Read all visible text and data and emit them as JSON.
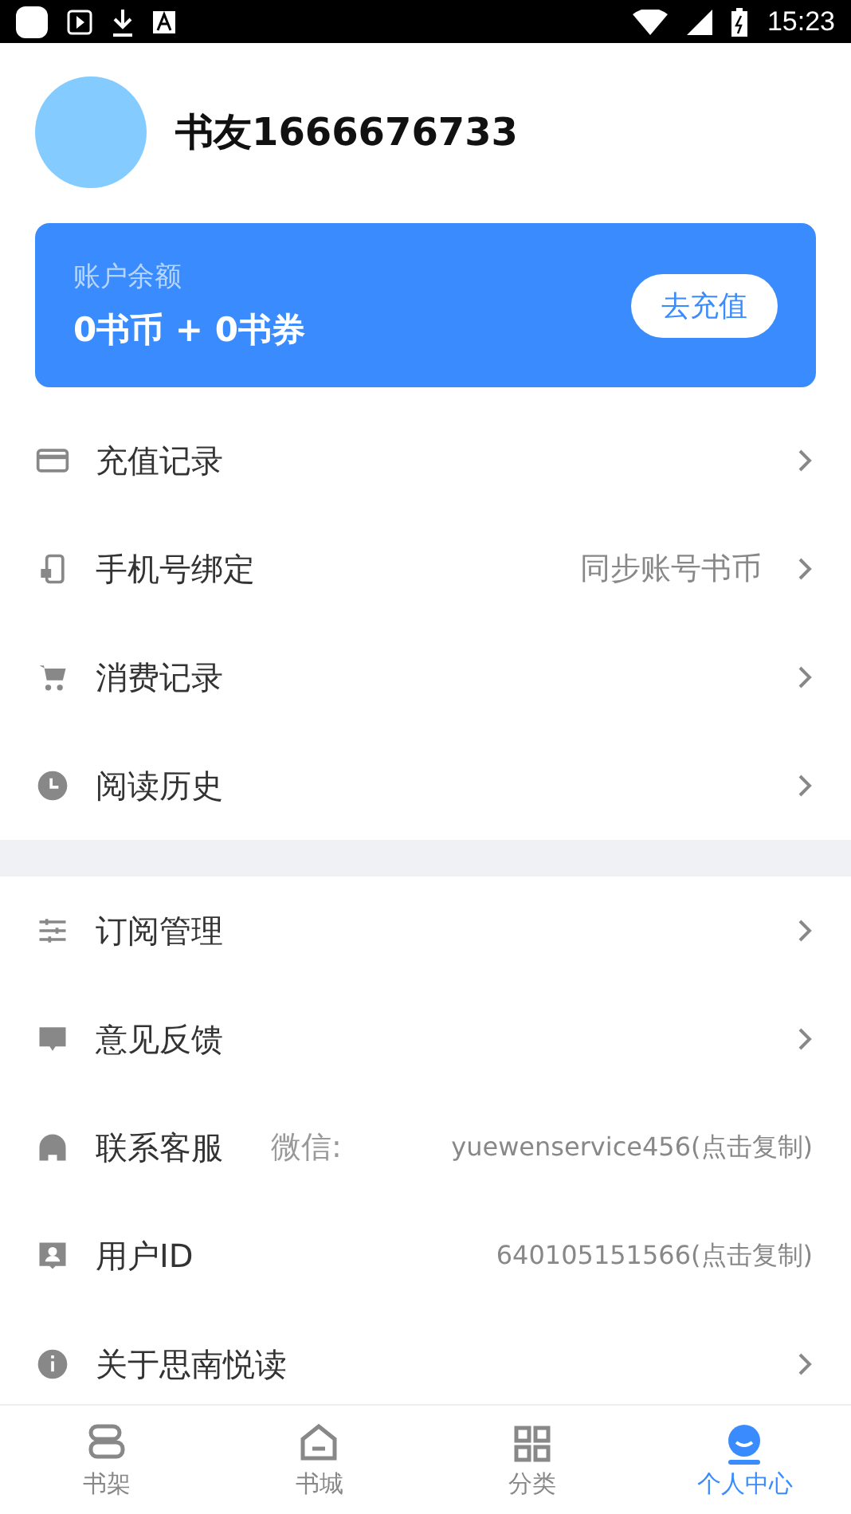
{
  "status_bar": {
    "time": "15:23"
  },
  "profile": {
    "name": "书友1666676733"
  },
  "balance": {
    "label": "账户余额",
    "amount": "0书币 + 0书券",
    "button": "去充值"
  },
  "groups": [
    {
      "rows": [
        {
          "kind": "link",
          "label": "充值记录"
        },
        {
          "kind": "link",
          "label": "手机号绑定",
          "value": "同步账号书币"
        },
        {
          "kind": "link",
          "label": "消费记录"
        },
        {
          "kind": "link",
          "label": "阅读历史"
        }
      ]
    },
    {
      "rows": [
        {
          "kind": "link",
          "label": "订阅管理"
        },
        {
          "kind": "link",
          "label": "意见反馈"
        },
        {
          "kind": "copy",
          "label": "联系客服",
          "note": "微信:",
          "value": "yuewenservice456(点击复制)"
        },
        {
          "kind": "copy",
          "label": "用户ID",
          "value": "640105151566(点击复制)"
        },
        {
          "kind": "link",
          "label": "关于思南悦读"
        }
      ]
    }
  ],
  "tabs": [
    {
      "label": "书架",
      "selected": false
    },
    {
      "label": "书城",
      "selected": false
    },
    {
      "label": "分类",
      "selected": false
    },
    {
      "label": "个人中心",
      "selected": true
    }
  ]
}
